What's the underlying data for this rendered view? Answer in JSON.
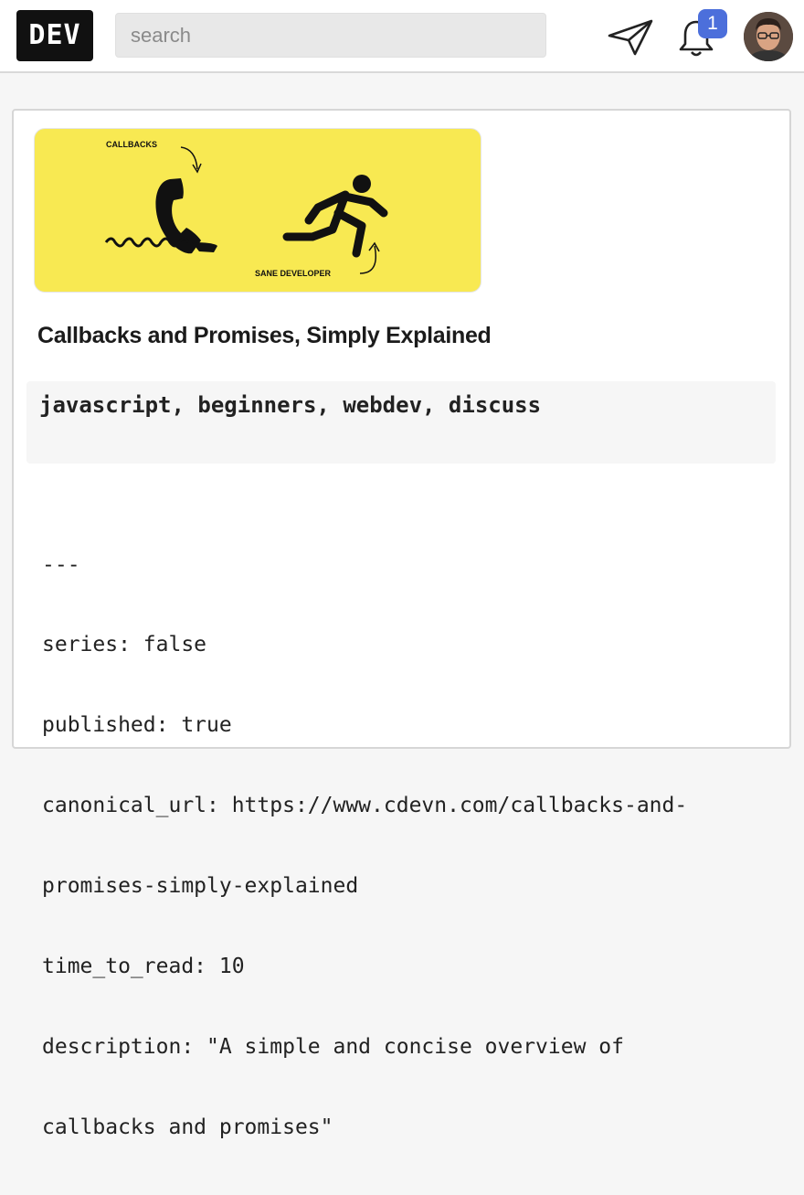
{
  "header": {
    "logo_text": "DEV",
    "search_placeholder": "search",
    "notification_count": "1",
    "icons": [
      "send-icon",
      "bell-icon"
    ],
    "accent_color": "#4c6fdb"
  },
  "article": {
    "cover": {
      "label_top": "CALLBACKS",
      "label_bottom": "SANE DEVELOPER",
      "background": "#f8e952"
    },
    "title": "Callbacks and Promises, Simply Explained",
    "tags": "javascript, beginners, webdev, discuss",
    "frontmatter": [
      "---",
      "series: false",
      "published: true",
      "canonical_url: https://www.cdevn.com/callbacks-and-",
      "promises-simply-explained",
      "time_to_read: 10",
      "description: \"A simple and concise overview of",
      "callbacks and promises\""
    ]
  }
}
